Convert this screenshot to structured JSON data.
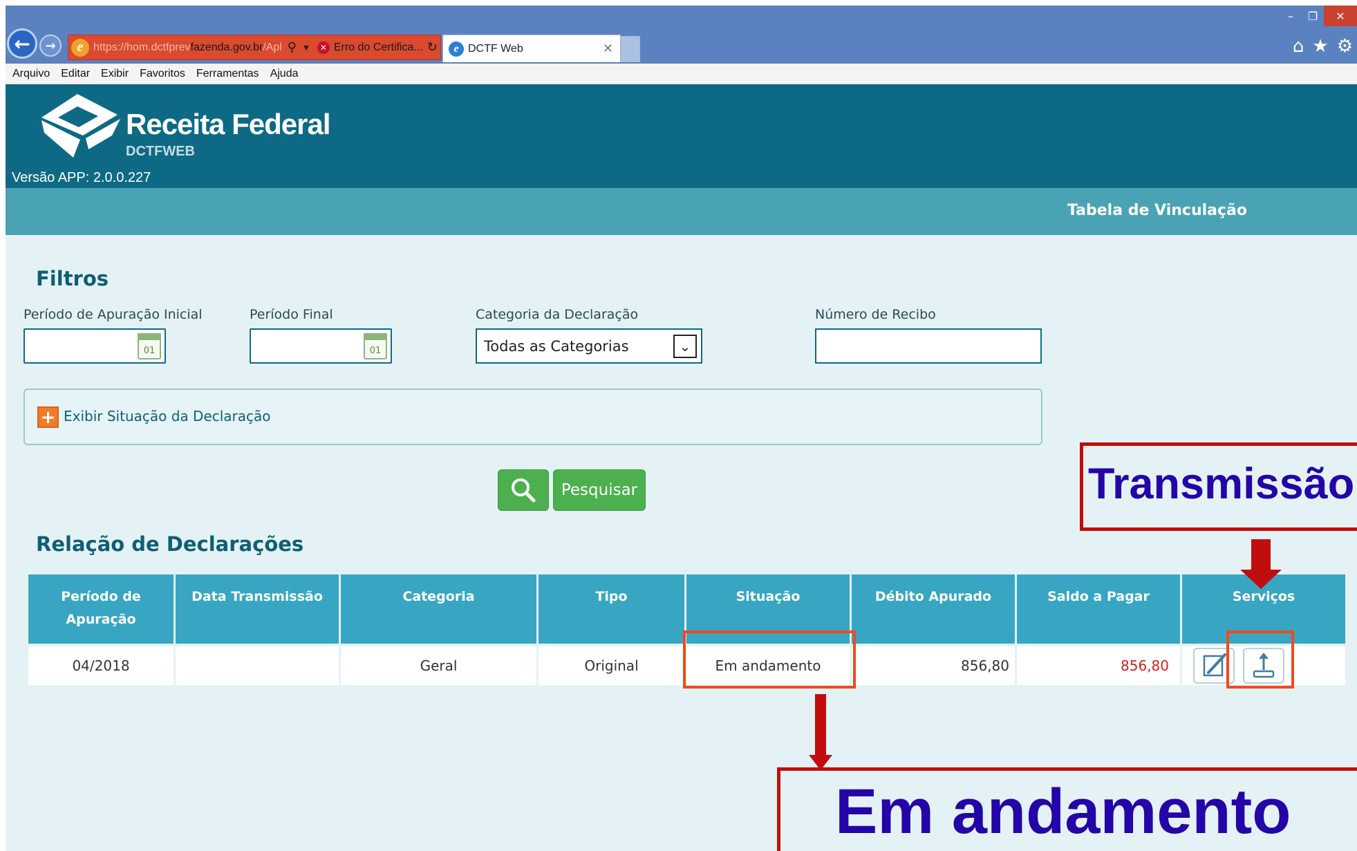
{
  "browser": {
    "url_prefix": "https://hom.dctfprev",
    "url_host": "fazenda.gov.br",
    "url_suffix": "/Apl",
    "cert_error_tab": "Erro do Certifica...",
    "active_tab": "DCTF Web",
    "menu": [
      "Arquivo",
      "Editar",
      "Exibir",
      "Favoritos",
      "Ferramentas",
      "Ajuda"
    ]
  },
  "header": {
    "brand": "Receita Federal",
    "subbrand": "DCTFWEB",
    "version": "Versão APP: 2.0.0.227",
    "nav_link": "Tabela de Vinculação"
  },
  "filters": {
    "title": "Filtros",
    "periodo_inicial_label": "Período de Apuração Inicial",
    "periodo_final_label": "Período Final",
    "categoria_label": "Categoria da Declaração",
    "categoria_value": "Todas as Categorias",
    "recibo_label": "Número de Recibo",
    "calendar_day": "01",
    "situacao_toggle": "Exibir Situação da Declaração",
    "search_button": "Pesquisar"
  },
  "results": {
    "title": "Relação de Declarações",
    "columns": [
      "Período de Apuração",
      "Data Transmissão",
      "Categoria",
      "Tipo",
      "Situação",
      "Débito Apurado",
      "Saldo a Pagar",
      "Serviços"
    ],
    "rows": [
      {
        "periodo": "04/2018",
        "data_transmissao": "",
        "categoria": "Geral",
        "tipo": "Original",
        "situacao": "Em andamento",
        "debito": "856,80",
        "saldo": "856,80"
      }
    ]
  },
  "annotations": {
    "transmissao": "Transmissão",
    "em_andamento": "Em andamento"
  },
  "colors": {
    "header_teal": "#0e6a84",
    "subnav_teal": "#4aa3b5",
    "table_header": "#38a6c2",
    "button_green": "#4cb04f",
    "annotation_red": "#c00e0e",
    "annotation_text": "#2405a8",
    "saldo_red": "#d21f1f"
  }
}
